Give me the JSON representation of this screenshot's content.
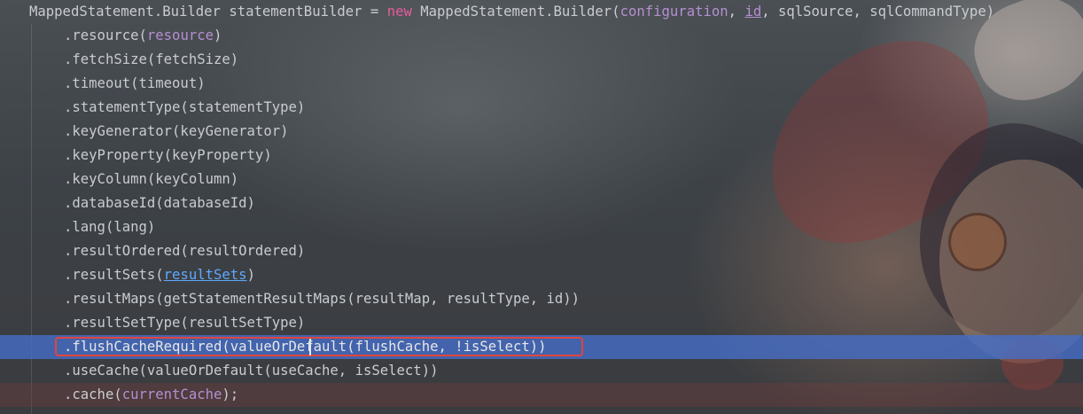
{
  "colors": {
    "keyword": "#e85a9a",
    "parameter": "#b58fd0",
    "link": "#5fa8ff",
    "current_line": "#466ec8",
    "highlight_border": "#e0453c",
    "text": "#c9ccd0"
  },
  "code": {
    "line1": {
      "a": "MappedStatement.Builder statementBuilder = ",
      "kw": "new",
      "b": " MappedStatement.Builder(",
      "p1": "configuration",
      "c": ", ",
      "p2": "id",
      "d": ", sqlSource, sqlCommandType)"
    },
    "line2": {
      "m": ".resource(",
      "p": "resource",
      "e": ")"
    },
    "line3": ".fetchSize(fetchSize)",
    "line4": ".timeout(timeout)",
    "line5": ".statementType(statementType)",
    "line6": ".keyGenerator(keyGenerator)",
    "line7": ".keyProperty(keyProperty)",
    "line8": ".keyColumn(keyColumn)",
    "line9": ".databaseId(databaseId)",
    "line10": ".lang(lang)",
    "line11": ".resultOrdered(resultOrdered)",
    "line12": {
      "m": ".resultSets(",
      "p": "resultSets",
      "e": ")"
    },
    "line13": ".resultMaps(getStatementResultMaps(resultMap, resultType, id))",
    "line14": ".resultSetType(resultSetType)",
    "line15": ".flushCacheRequired(valueOrDefault(flushCache, !isSelect))",
    "line16": ".useCache(valueOrDefault(useCache, isSelect))",
    "line17": {
      "m": ".cache(",
      "p": "currentCache",
      "e": ");"
    }
  }
}
